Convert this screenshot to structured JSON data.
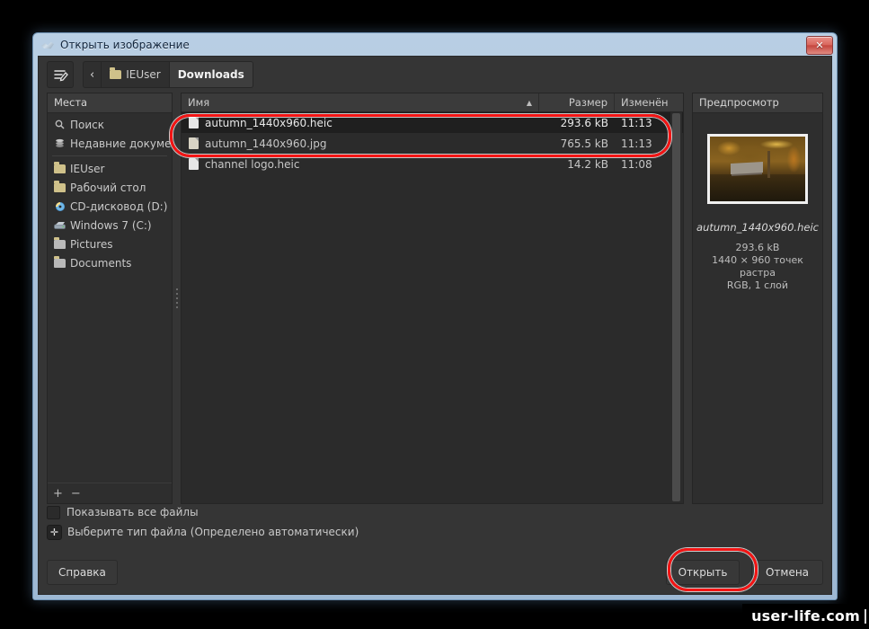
{
  "window": {
    "title": "Открыть изображение",
    "icon": "gimp-wilber-icon",
    "close_label": "✕"
  },
  "toolbar": {
    "create_folder_icon": "edit-path-icon",
    "back_label": "‹",
    "path_segments": [
      {
        "label": "IEUser",
        "active": false,
        "icon": "folder-icon"
      },
      {
        "label": "Downloads",
        "active": true,
        "icon": ""
      }
    ]
  },
  "places": {
    "header": "Места",
    "items": [
      {
        "label": "Поиск",
        "icon": "search-icon",
        "glyph": "⚲"
      },
      {
        "label": "Недавние докумен...",
        "icon": "recent-documents-icon",
        "glyph": "☰"
      },
      {
        "label": "IEUser",
        "icon": "folder-icon",
        "glyph": ""
      },
      {
        "label": "Рабочий стол",
        "icon": "folder-icon",
        "glyph": ""
      },
      {
        "label": "CD-дисковод (D:) ...",
        "icon": "cd-drive-icon",
        "glyph": "◉"
      },
      {
        "label": "Windows 7 (C:)",
        "icon": "hard-disk-icon",
        "glyph": "▭"
      },
      {
        "label": "Pictures",
        "icon": "folder-icon",
        "glyph": ""
      },
      {
        "label": "Documents",
        "icon": "folder-icon",
        "glyph": ""
      }
    ],
    "add_label": "+",
    "remove_label": "−"
  },
  "file_list": {
    "columns": {
      "name": "Имя",
      "sort_indicator": "▲",
      "size": "Размер",
      "modified": "Изменён"
    },
    "rows": [
      {
        "name": "autumn_1440x960.heic",
        "size": "293.6 kB",
        "modified": "11:13",
        "selected": true,
        "icon": "file-icon"
      },
      {
        "name": "autumn_1440x960.jpg",
        "size": "765.5 kB",
        "modified": "11:13",
        "selected": false,
        "icon": "image-file-icon"
      },
      {
        "name": "channel logo.heic",
        "size": "14.2 kB",
        "modified": "11:08",
        "selected": false,
        "icon": "file-icon"
      }
    ]
  },
  "preview": {
    "header": "Предпросмотр",
    "filename": "autumn_1440x960.heic",
    "size": "293.6 kB",
    "dimensions": "1440 × 960 точек растра",
    "colormode": "RGB, 1 слой"
  },
  "options": {
    "show_all_files": "Показывать все файлы",
    "select_file_type": "Выберите тип файла (Определено автоматически)",
    "expander_glyph": "✛"
  },
  "actions": {
    "help": "Справка",
    "open": "Открыть",
    "cancel": "Отмена"
  },
  "watermark": {
    "text": "user-life.com"
  },
  "colors": {
    "highlight": "#f41414",
    "dialog_bg": "#353535",
    "selection_bg": "#1f1f1f"
  }
}
